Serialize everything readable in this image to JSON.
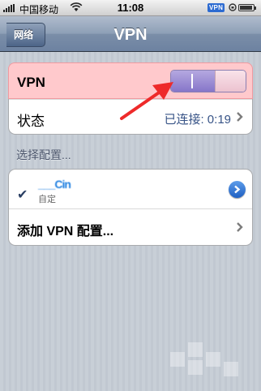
{
  "status_bar": {
    "carrier": "中国移动",
    "time": "11:08",
    "vpn_badge": "VPN"
  },
  "nav": {
    "back_label": "网络",
    "title": "VPN"
  },
  "vpn_row": {
    "label": "VPN",
    "toggle_on": true,
    "on_symbol": "I"
  },
  "status_row": {
    "label": "状态",
    "value": "已连接: 0:19"
  },
  "section_header": "选择配置...",
  "configs": [
    {
      "name": "___Cin",
      "subtitle": "自定",
      "selected": true
    }
  ],
  "add_config_label": "添加 VPN 配置...",
  "colors": {
    "vpn_row_highlight": "#ffc9cc",
    "annotation_arrow": "#ee2a2a",
    "toggle_on": "#8676c9",
    "value_blue": "#385487"
  }
}
